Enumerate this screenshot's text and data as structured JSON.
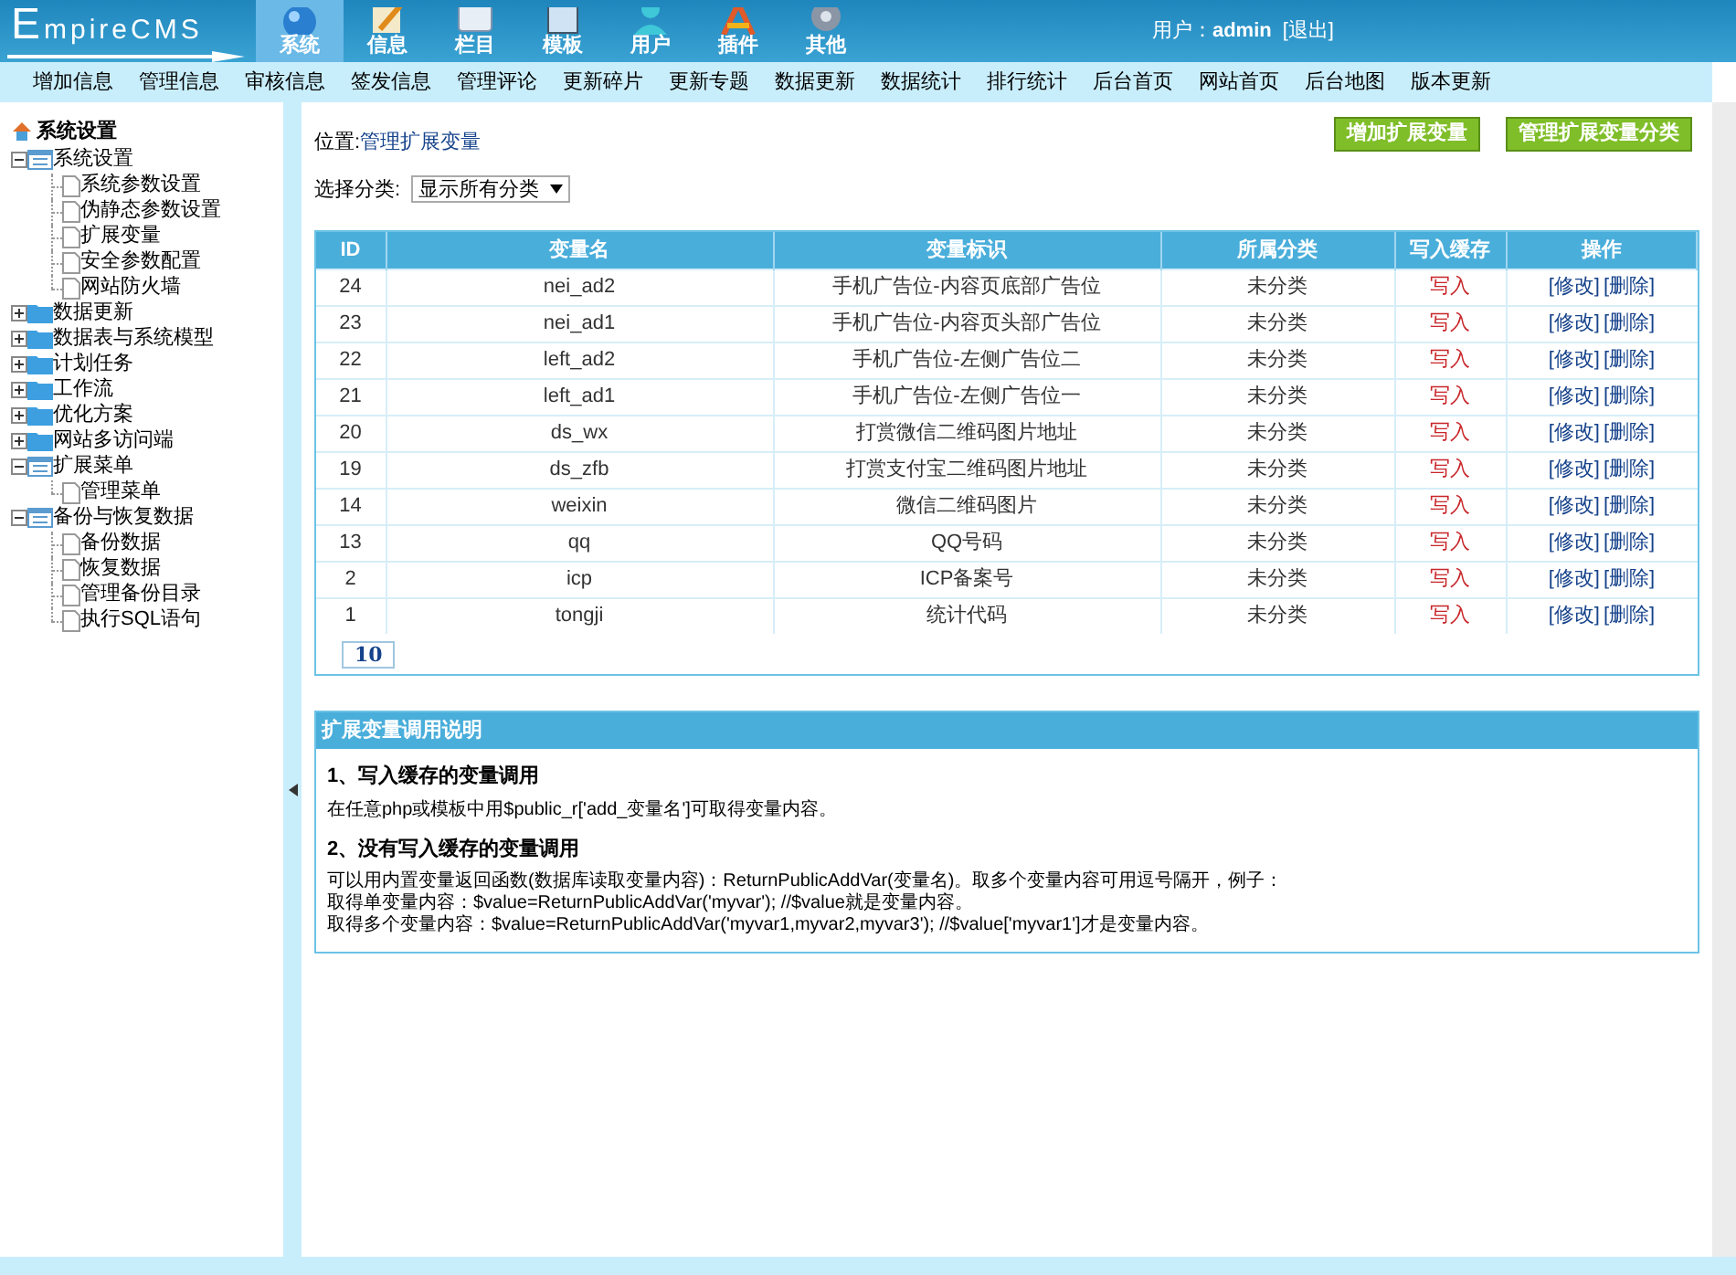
{
  "header": {
    "logo": "EmpireCMS",
    "tabs": [
      {
        "label": "系统",
        "selected": true
      },
      {
        "label": "信息",
        "selected": false
      },
      {
        "label": "栏目",
        "selected": false
      },
      {
        "label": "模板",
        "selected": false
      },
      {
        "label": "用户",
        "selected": false
      },
      {
        "label": "插件",
        "selected": false
      },
      {
        "label": "其他",
        "selected": false
      }
    ],
    "user_label": "用户：",
    "user": "admin",
    "logout": "[退出]"
  },
  "menu": [
    "增加信息",
    "管理信息",
    "审核信息",
    "签发信息",
    "管理评论",
    "更新碎片",
    "更新专题",
    "数据更新",
    "数据统计",
    "排行统计",
    "后台首页",
    "网站首页",
    "后台地图",
    "版本更新"
  ],
  "sidebar": {
    "title": "系统设置",
    "tree": [
      {
        "label": "系统设置",
        "kind": "folder",
        "expanded": true,
        "children": [
          {
            "label": "系统参数设置",
            "kind": "page"
          },
          {
            "label": "伪静态参数设置",
            "kind": "page"
          },
          {
            "label": "扩展变量",
            "kind": "page"
          },
          {
            "label": "安全参数配置",
            "kind": "page"
          },
          {
            "label": "网站防火墙",
            "kind": "page"
          }
        ]
      },
      {
        "label": "数据更新",
        "kind": "folder",
        "expanded": false
      },
      {
        "label": "数据表与系统模型",
        "kind": "folder",
        "expanded": false
      },
      {
        "label": "计划任务",
        "kind": "folder",
        "expanded": false
      },
      {
        "label": "工作流",
        "kind": "folder",
        "expanded": false
      },
      {
        "label": "优化方案",
        "kind": "folder",
        "expanded": false
      },
      {
        "label": "网站多访问端",
        "kind": "folder",
        "expanded": false
      },
      {
        "label": "扩展菜单",
        "kind": "folder",
        "expanded": true,
        "children": [
          {
            "label": "管理菜单",
            "kind": "page"
          }
        ]
      },
      {
        "label": "备份与恢复数据",
        "kind": "folder",
        "expanded": true,
        "children": [
          {
            "label": "备份数据",
            "kind": "page"
          },
          {
            "label": "恢复数据",
            "kind": "page"
          },
          {
            "label": "管理备份目录",
            "kind": "page"
          },
          {
            "label": "执行SQL语句",
            "kind": "page"
          }
        ]
      }
    ]
  },
  "breadcrumb": {
    "label": "位置:",
    "link": "管理扩展变量"
  },
  "buttons": [
    "增加扩展变量",
    "管理扩展变量分类"
  ],
  "filter": {
    "label": "选择分类:",
    "value": "显示所有分类"
  },
  "table": {
    "columns": [
      "ID",
      "变量名",
      "变量标识",
      "所属分类",
      "写入缓存",
      "操作"
    ],
    "rows": [
      {
        "id": "24",
        "name": "nei_ad2",
        "title": "手机广告位-内容页底部广告位",
        "category": "未分类",
        "cache": "写入",
        "actions": [
          "[修改]",
          "[删除]"
        ]
      },
      {
        "id": "23",
        "name": "nei_ad1",
        "title": "手机广告位-内容页头部广告位",
        "category": "未分类",
        "cache": "写入",
        "actions": [
          "[修改]",
          "[删除]"
        ]
      },
      {
        "id": "22",
        "name": "left_ad2",
        "title": "手机广告位-左侧广告位二",
        "category": "未分类",
        "cache": "写入",
        "actions": [
          "[修改]",
          "[删除]"
        ]
      },
      {
        "id": "21",
        "name": "left_ad1",
        "title": "手机广告位-左侧广告位一",
        "category": "未分类",
        "cache": "写入",
        "actions": [
          "[修改]",
          "[删除]"
        ]
      },
      {
        "id": "20",
        "name": "ds_wx",
        "title": "打赏微信二维码图片地址",
        "category": "未分类",
        "cache": "写入",
        "actions": [
          "[修改]",
          "[删除]"
        ]
      },
      {
        "id": "19",
        "name": "ds_zfb",
        "title": "打赏支付宝二维码图片地址",
        "category": "未分类",
        "cache": "写入",
        "actions": [
          "[修改]",
          "[删除]"
        ]
      },
      {
        "id": "14",
        "name": "weixin",
        "title": "微信二维码图片",
        "category": "未分类",
        "cache": "写入",
        "actions": [
          "[修改]",
          "[删除]"
        ]
      },
      {
        "id": "13",
        "name": "qq",
        "title": "QQ号码",
        "category": "未分类",
        "cache": "写入",
        "actions": [
          "[修改]",
          "[删除]"
        ]
      },
      {
        "id": "2",
        "name": "icp",
        "title": "ICP备案号",
        "category": "未分类",
        "cache": "写入",
        "actions": [
          "[修改]",
          "[删除]"
        ]
      },
      {
        "id": "1",
        "name": "tongji",
        "title": "统计代码",
        "category": "未分类",
        "cache": "写入",
        "actions": [
          "[修改]",
          "[删除]"
        ]
      }
    ],
    "pages": [
      {
        "label": "10",
        "selected": true
      }
    ]
  },
  "notes": {
    "title": "扩展变量调用说明",
    "sections": [
      {
        "heading": "1、写入缓存的变量调用",
        "lines": [
          "在任意php或模板中用$public_r['add_变量名']可取得变量内容。"
        ]
      },
      {
        "heading": "2、没有写入缓存的变量调用",
        "lines": [
          "可以用内置变量返回函数(数据库读取变量内容)：ReturnPublicAddVar(变量名)。取多个变量内容可用逗号隔开，例子：",
          "取得单变量内容：$value=ReturnPublicAddVar('myvar'); //$value就是变量内容。",
          "取得多个变量内容：$value=ReturnPublicAddVar('myvar1,myvar2,myvar3'); //$value['myvar1']才是变量内容。"
        ]
      }
    ]
  }
}
